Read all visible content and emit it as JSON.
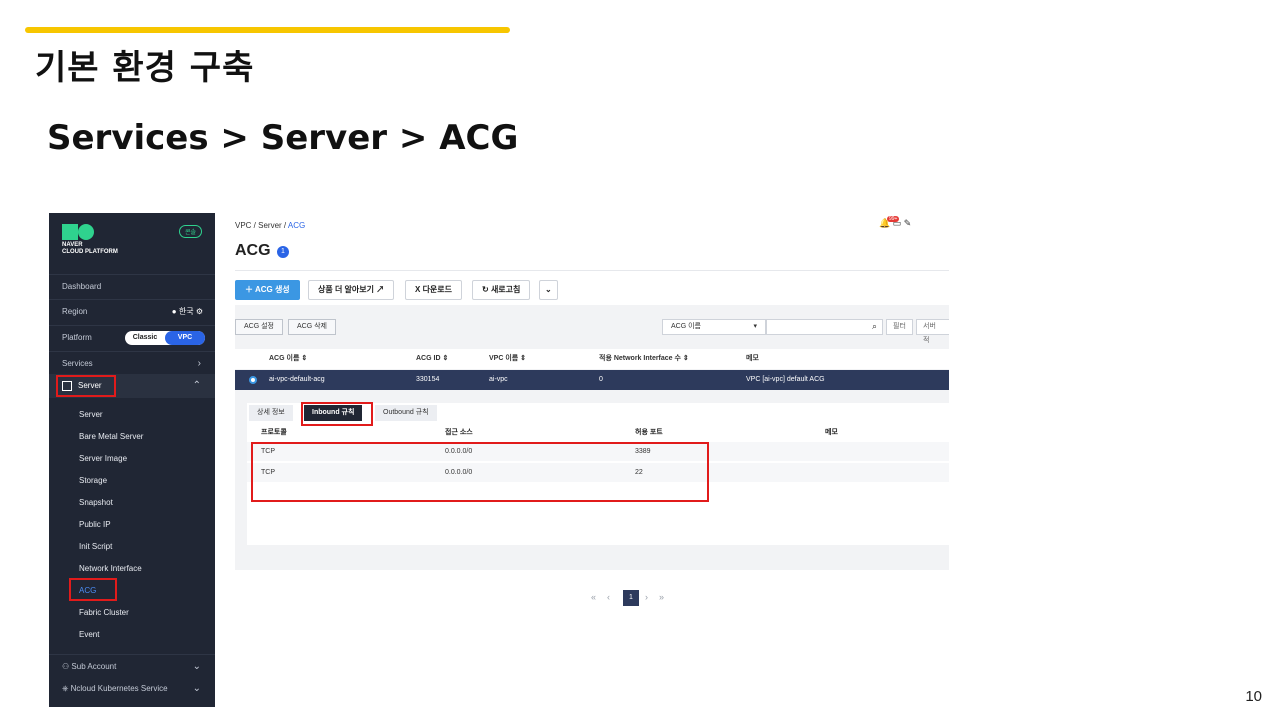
{
  "slide": {
    "title": "기본 환경 구축",
    "subtitle": "Services > Server > ACG",
    "page_number": "10",
    "accent_color": "#f7c600"
  },
  "sidebar": {
    "brand_line1": "NAVER",
    "brand_line2": "CLOUD PLATFORM",
    "console_badge": "콘솔",
    "dashboard": "Dashboard",
    "region_label": "Region",
    "region_value": "한국",
    "platform_label": "Platform",
    "platform_options": [
      "Classic",
      "VPC"
    ],
    "platform_selected": "VPC",
    "services_label": "Services",
    "server_label": "Server",
    "server_items": [
      "Server",
      "Bare Metal Server",
      "Server Image",
      "Storage",
      "Snapshot",
      "Public IP",
      "Init Script",
      "Network Interface",
      "ACG",
      "Fabric Cluster",
      "Event"
    ],
    "active_item": "ACG",
    "sub_account": "Sub Account",
    "kubernetes": "Ncloud Kubernetes Service"
  },
  "main": {
    "breadcrumb": [
      "VPC",
      "Server",
      "ACG"
    ],
    "page_title": "ACG",
    "count": "1",
    "notif_badge": "99+",
    "toolbar": {
      "create": "ACG 생성",
      "learn_more": "상품 더 알아보기",
      "download": "다운로드",
      "refresh": "새로고침"
    },
    "filter": {
      "settings": "ACG 설정",
      "delete": "ACG 삭제",
      "select_value": "ACG 이름",
      "filter_btn": "필터",
      "server_btn": "서버 적"
    },
    "table": {
      "headers": [
        "ACG 이름",
        "ACG ID",
        "VPC 이름",
        "적용 Network Interface 수",
        "메모"
      ],
      "rows": [
        [
          "ai-vpc-default-acg",
          "330154",
          "ai-vpc",
          "0",
          "VPC [ai-vpc] default ACG"
        ]
      ]
    },
    "detail": {
      "tabs": [
        "상세 정보",
        "Inbound 규칙",
        "Outbound 규칙"
      ],
      "active_tab": "Inbound 규칙",
      "headers": [
        "프로토콜",
        "접근 소스",
        "허용 포트",
        "메모"
      ],
      "rows": [
        [
          "TCP",
          "0.0.0.0/0",
          "3389",
          ""
        ],
        [
          "TCP",
          "0.0.0.0/0",
          "22",
          ""
        ]
      ]
    },
    "pager": {
      "current": "1"
    }
  },
  "highlight_color": "#e11b1b"
}
